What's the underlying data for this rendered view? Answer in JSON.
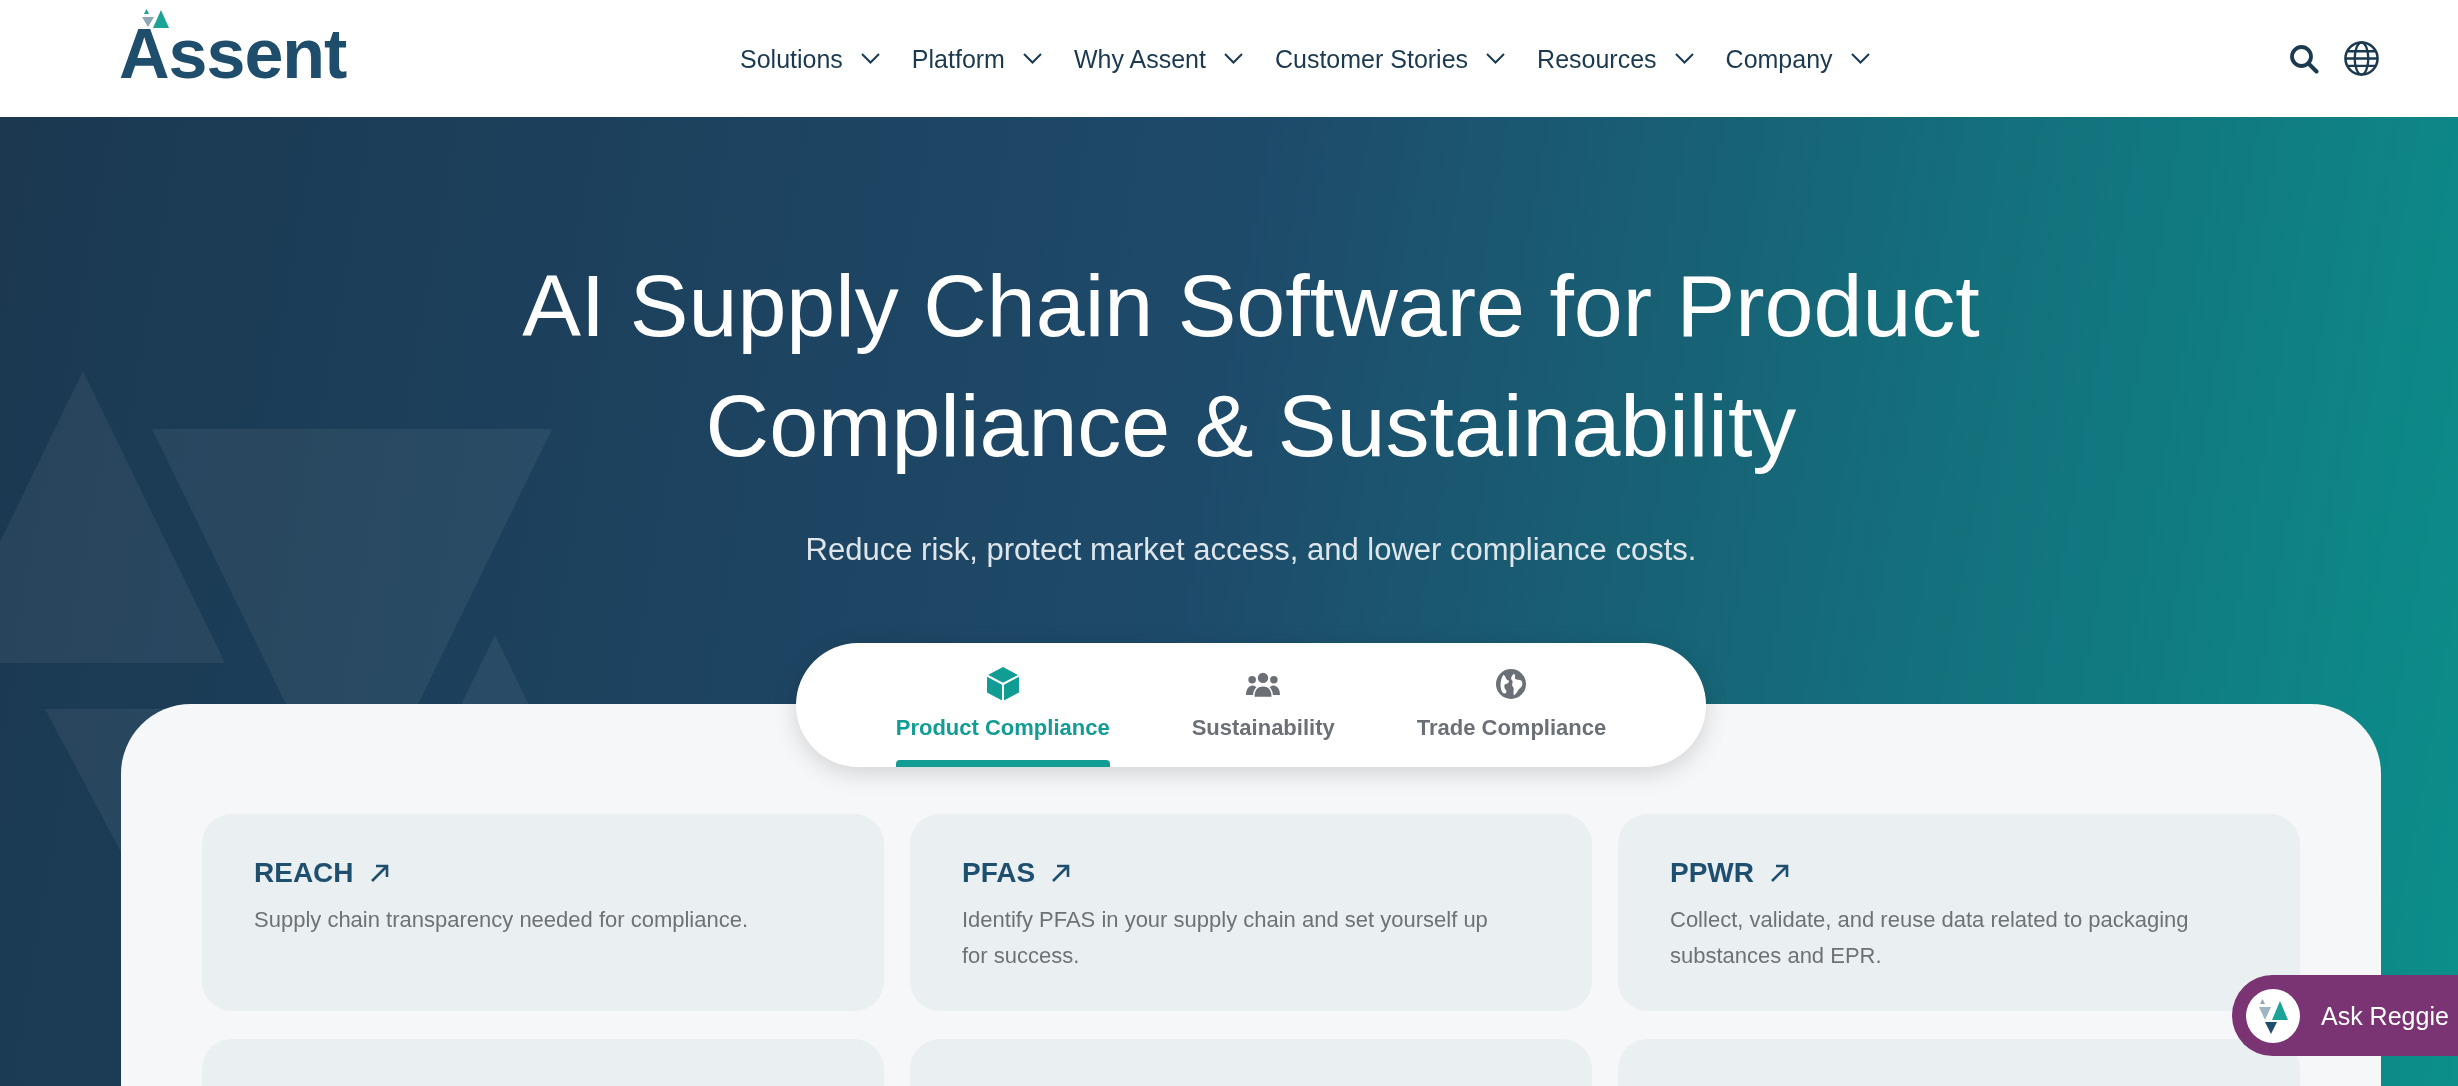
{
  "header": {
    "logo": "Assent",
    "nav": [
      "Solutions",
      "Platform",
      "Why Assent",
      "Customer Stories",
      "Resources",
      "Company"
    ]
  },
  "hero": {
    "title": "AI Supply Chain Software for Product Compliance & Sustainability",
    "subtitle": "Reduce risk, protect market access, and lower compliance costs."
  },
  "tabs": [
    {
      "label": "Product Compliance",
      "selected": true
    },
    {
      "label": "Sustainability",
      "selected": false
    },
    {
      "label": "Trade Compliance",
      "selected": false
    }
  ],
  "cards": [
    {
      "title": "REACH",
      "description": "Supply chain transparency needed for compliance."
    },
    {
      "title": "PFAS",
      "description": "Identify PFAS in your supply chain and set yourself up for success."
    },
    {
      "title": "PPWR",
      "description": "Collect, validate, and reuse data related to packaging substances and EPR."
    }
  ],
  "chat_button": {
    "label": "Ask Reggie"
  }
}
